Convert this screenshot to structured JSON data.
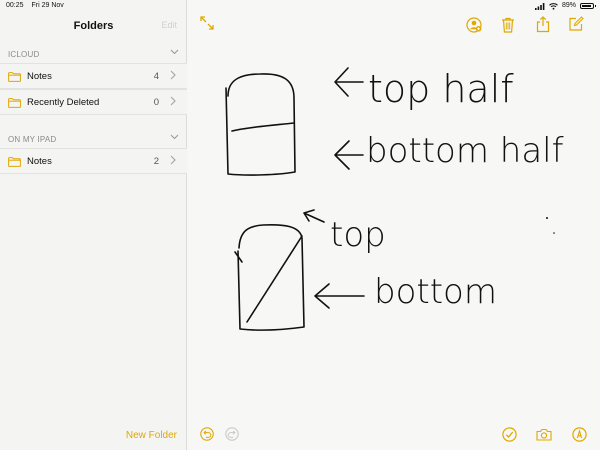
{
  "status": {
    "time": "00:25",
    "date": "Fri 29 Nov",
    "battery": "89%",
    "battery_level": 0.89
  },
  "sidebar": {
    "title": "Folders",
    "edit_label": "Edit",
    "sections": [
      {
        "label": "ICLOUD",
        "items": [
          {
            "label": "Notes",
            "count": "4"
          },
          {
            "label": "Recently Deleted",
            "count": "0"
          }
        ]
      },
      {
        "label": "ON MY IPAD",
        "items": [
          {
            "label": "Notes",
            "count": "2"
          }
        ]
      }
    ],
    "new_folder_label": "New Folder"
  },
  "note": {
    "handwriting": [
      "top half",
      "bottom half",
      "top",
      "bottom"
    ]
  },
  "icons": {
    "expand": "expand-arrows-icon",
    "collaborator": "add-person-icon",
    "trash": "trash-icon",
    "share": "share-icon",
    "compose": "compose-icon",
    "undo": "undo-icon",
    "redo": "redo-icon",
    "checklist": "checkmark-circle-icon",
    "camera": "camera-icon",
    "markup": "markup-pen-icon"
  },
  "colors": {
    "accent": "#e0a800",
    "ink": "#111111"
  }
}
